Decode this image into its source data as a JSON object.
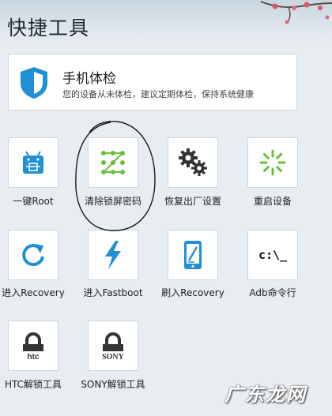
{
  "header": {
    "title": "快捷工具"
  },
  "health": {
    "title": "手机体检",
    "description": "您的设备从未体检，建议定期体检，保持系统健康"
  },
  "tools": [
    {
      "id": "one-key-root",
      "label": "一键Root",
      "icon": "android-icon"
    },
    {
      "id": "clear-lock-password",
      "label": "清除锁屏密码",
      "icon": "pattern-lock-icon"
    },
    {
      "id": "factory-reset",
      "label": "恢复出厂设置",
      "icon": "gears-icon"
    },
    {
      "id": "reboot-device",
      "label": "重启设备",
      "icon": "loading-spinner-icon"
    },
    {
      "id": "enter-recovery",
      "label": "进入Recovery",
      "icon": "refresh-icon"
    },
    {
      "id": "enter-fastboot",
      "label": "进入Fastboot",
      "icon": "lightning-icon"
    },
    {
      "id": "flash-recovery",
      "label": "刷入Recovery",
      "icon": "phone-edit-icon"
    },
    {
      "id": "adb-command",
      "label": "Adb命令行",
      "icon": "terminal-icon",
      "icon_text": "c:\\_"
    },
    {
      "id": "htc-unlock",
      "label": "HTC解锁工具",
      "icon": "htc-lock-icon",
      "icon_text": "htc"
    },
    {
      "id": "sony-unlock",
      "label": "SONY解锁工具",
      "icon": "sony-lock-icon",
      "icon_text": "SONY"
    }
  ],
  "watermark": "广东龙网",
  "colors": {
    "accent_blue": "#1f8fd6",
    "accent_green": "#6abf3a",
    "icon_dark": "#333333"
  }
}
